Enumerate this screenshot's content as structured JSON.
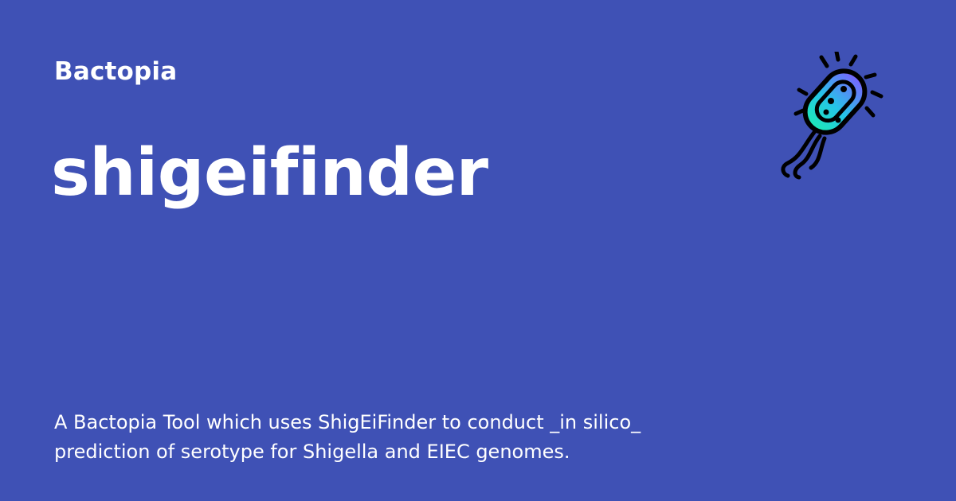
{
  "card": {
    "site_name": "Bactopia",
    "title": "shigeifinder",
    "description": "A Bactopia Tool which uses ShigEiFinder to conduct _in silico_ prediction of serotype for Shigella and EIEC genomes.",
    "logo_icon": "bacterium-icon"
  },
  "colors": {
    "background": "#3f51b5",
    "text": "#ffffff",
    "logo_gradient_start": "#7b61ff",
    "logo_gradient_end": "#1de9b6"
  }
}
